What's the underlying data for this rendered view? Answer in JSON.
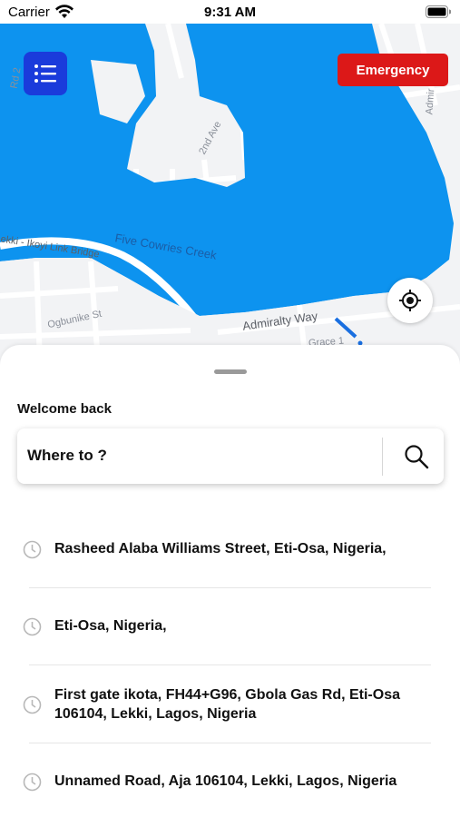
{
  "status_bar": {
    "carrier": "Carrier",
    "time": "9:31 AM"
  },
  "map": {
    "labels": {
      "second_ave": "2nd Ave",
      "five_cowries": "Five Cowries Creek",
      "link_bridge": "ekki - Ikoyi Link Bridge",
      "ogbunike": "Ogbunike St",
      "admiralty": "Admiralty Way",
      "admir": "Admir",
      "rd": "Rd 2",
      "grace": "Grace 1"
    },
    "colors": {
      "water": "#0d93ef",
      "land": "#f2f3f5",
      "road": "#ffffff",
      "route": "#1a6fe0"
    }
  },
  "header": {
    "emergency_label": "Emergency",
    "menu_icon": "list-icon",
    "menu_color": "#1a3bdb",
    "emergency_color": "#dc1818"
  },
  "locate": {
    "icon": "crosshair-icon"
  },
  "sheet": {
    "welcome": "Welcome back",
    "search": {
      "placeholder": "Where to ?",
      "icon": "search-icon"
    },
    "history": [
      {
        "icon": "clock-icon",
        "text": "Rasheed Alaba Williams Street, Eti-Osa, Nigeria,"
      },
      {
        "icon": "clock-icon",
        "text": "Eti-Osa, Nigeria,"
      },
      {
        "icon": "clock-icon",
        "text": "First gate ikota, FH44+G96, Gbola Gas Rd, Eti-Osa 106104, Lekki, Lagos, Nigeria"
      },
      {
        "icon": "clock-icon",
        "text": "Unnamed Road, Aja 106104, Lekki, Lagos, Nigeria"
      }
    ]
  }
}
